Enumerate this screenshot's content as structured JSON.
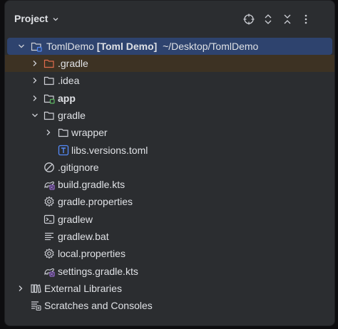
{
  "panel": {
    "title": "Project",
    "buttons": [
      "select-opened-file",
      "expand-all",
      "collapse-all",
      "options"
    ]
  },
  "tree": [
    {
      "label": "TomlDemo",
      "bold_suffix": "[Toml Demo]",
      "path": "~/Desktop/TomlDemo",
      "icon": "module-folder-icon",
      "expanded": true
    },
    {
      "label": ".gradle",
      "icon": "folder-icon",
      "expanded": false
    },
    {
      "label": ".idea",
      "icon": "folder-icon",
      "expanded": false
    },
    {
      "label": "app",
      "icon": "module-folder-icon",
      "expanded": false
    },
    {
      "label": "gradle",
      "icon": "folder-icon",
      "expanded": true
    },
    {
      "label": "wrapper",
      "icon": "folder-icon",
      "expanded": false
    },
    {
      "label": "libs.versions.toml",
      "icon": "toml-file-icon"
    },
    {
      "label": ".gitignore",
      "icon": "gitignore-icon"
    },
    {
      "label": "build.gradle.kts",
      "icon": "gradle-kts-icon"
    },
    {
      "label": "gradle.properties",
      "icon": "gear-icon"
    },
    {
      "label": "gradlew",
      "icon": "terminal-icon"
    },
    {
      "label": "gradlew.bat",
      "icon": "text-lines-icon"
    },
    {
      "label": "local.properties",
      "icon": "gear-icon"
    },
    {
      "label": "settings.gradle.kts",
      "icon": "gradle-kts-icon"
    },
    {
      "label": "External Libraries",
      "icon": "library-icon",
      "expanded": false
    },
    {
      "label": "Scratches and Consoles",
      "icon": "scratches-icon"
    }
  ],
  "colors": {
    "background": "#2b2d30",
    "selection": "#2e436e",
    "excluded_highlight": "#3d3223",
    "excluded_folder": "#e06c4c",
    "module_badge": "#5fb865",
    "toml_icon": "#548af7",
    "kts_badge": "#a571e6"
  }
}
